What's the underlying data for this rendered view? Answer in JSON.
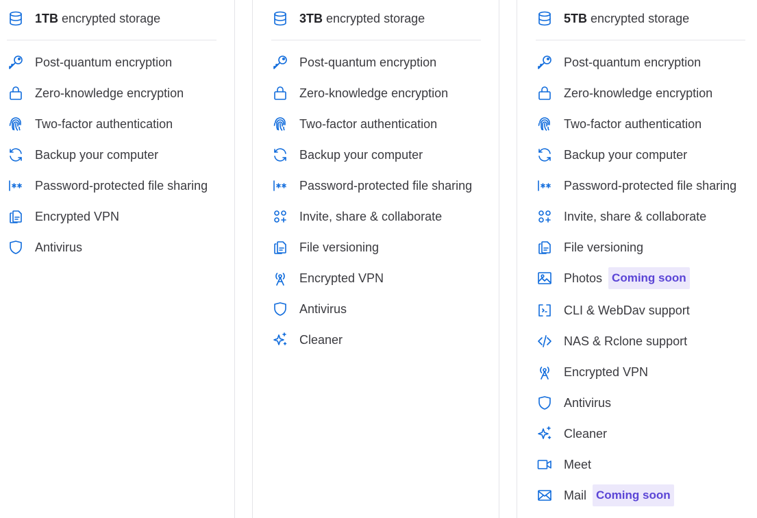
{
  "plans": [
    {
      "storage_amount": "1TB",
      "storage_suffix": " encrypted storage",
      "features": [
        {
          "label": "Post-quantum encryption",
          "icon": "key-icon"
        },
        {
          "label": "Zero-knowledge encryption",
          "icon": "lock-icon"
        },
        {
          "label": "Two-factor authentication",
          "icon": "fingerprint-icon"
        },
        {
          "label": "Backup your computer",
          "icon": "sync-icon"
        },
        {
          "label": "Password-protected file sharing",
          "icon": "password-icon"
        },
        {
          "label": "Encrypted VPN",
          "icon": "file-copy-icon"
        },
        {
          "label": "Antivirus",
          "icon": "shield-icon"
        }
      ]
    },
    {
      "storage_amount": "3TB",
      "storage_suffix": " encrypted storage",
      "features": [
        {
          "label": "Post-quantum encryption",
          "icon": "key-icon"
        },
        {
          "label": "Zero-knowledge encryption",
          "icon": "lock-icon"
        },
        {
          "label": "Two-factor authentication",
          "icon": "fingerprint-icon"
        },
        {
          "label": "Backup your computer",
          "icon": "sync-icon"
        },
        {
          "label": "Password-protected file sharing",
          "icon": "password-icon"
        },
        {
          "label": "Invite, share & collaborate",
          "icon": "users-icon"
        },
        {
          "label": "File versioning",
          "icon": "file-copy-icon"
        },
        {
          "label": "Encrypted VPN",
          "icon": "antenna-icon"
        },
        {
          "label": "Antivirus",
          "icon": "shield-icon"
        },
        {
          "label": "Cleaner",
          "icon": "sparkle-icon"
        }
      ]
    },
    {
      "storage_amount": "5TB",
      "storage_suffix": " encrypted storage",
      "features": [
        {
          "label": "Post-quantum encryption",
          "icon": "key-icon"
        },
        {
          "label": "Zero-knowledge encryption",
          "icon": "lock-icon"
        },
        {
          "label": "Two-factor authentication",
          "icon": "fingerprint-icon"
        },
        {
          "label": "Backup your computer",
          "icon": "sync-icon"
        },
        {
          "label": "Password-protected file sharing",
          "icon": "password-icon"
        },
        {
          "label": "Invite, share & collaborate",
          "icon": "users-icon"
        },
        {
          "label": "File versioning",
          "icon": "file-copy-icon"
        },
        {
          "label": "Photos",
          "icon": "image-icon",
          "badge": "Coming soon"
        },
        {
          "label": "CLI & WebDav support",
          "icon": "terminal-icon"
        },
        {
          "label": "NAS & Rclone support",
          "icon": "code-icon"
        },
        {
          "label": "Encrypted VPN",
          "icon": "antenna-icon"
        },
        {
          "label": "Antivirus",
          "icon": "shield-icon"
        },
        {
          "label": "Cleaner",
          "icon": "sparkle-icon"
        },
        {
          "label": "Meet",
          "icon": "video-camera-icon"
        },
        {
          "label": "Mail",
          "icon": "envelope-icon",
          "badge": "Coming soon"
        }
      ]
    }
  ],
  "colors": {
    "icon": "#0f6bdc",
    "text": "#3a3a3f",
    "badge_bg": "#ece8fb",
    "badge_text": "#5b45d6",
    "divider": "#e4e4e8"
  }
}
